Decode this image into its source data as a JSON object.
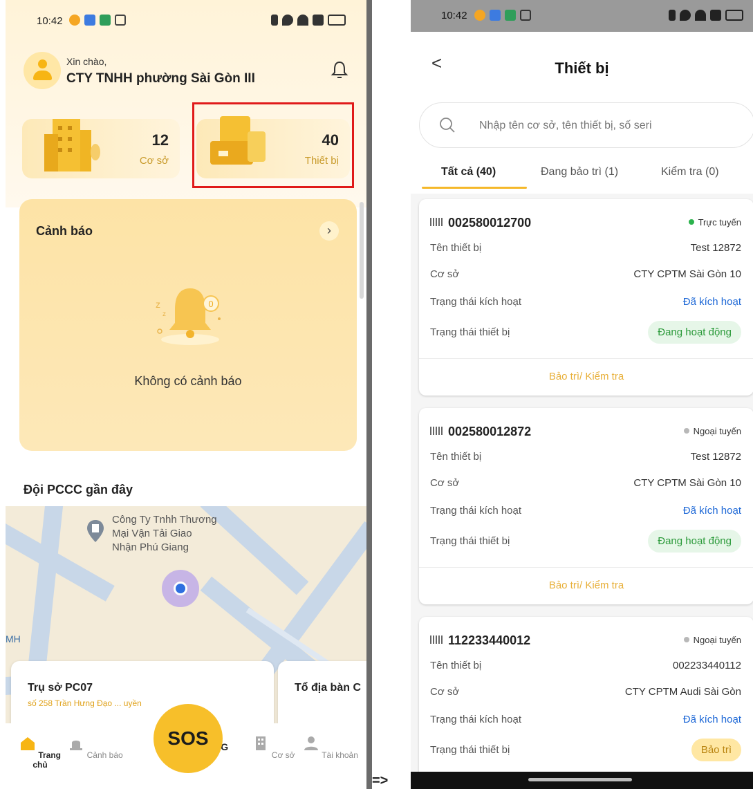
{
  "left_screen": {
    "status_time": "10:42",
    "greeting": "Xin chào,",
    "company": "CTY TNHH phường Sài Gòn III",
    "stats": [
      {
        "value": "12",
        "label": "Cơ sở"
      },
      {
        "value": "40",
        "label": "Thiết bị"
      }
    ],
    "alert": {
      "title": "Cảnh báo",
      "arrow": "›",
      "bell_count": "0",
      "empty_text": "Không có cảnh báo"
    },
    "pccc_title": "Đội PCCC gần đây",
    "map": {
      "place_label_1": "Công Ty Tnhh Thương",
      "place_label_2": "Mại Vận Tải Giao",
      "place_label_3": "Nhận Phú Giang",
      "edge_label": "MH"
    },
    "cards": [
      {
        "title": "Trụ sở PC07",
        "sub": "số 258 Trần Hưng Đạo ... uyền"
      },
      {
        "title": "Tổ địa bàn C",
        "sub": ""
      }
    ],
    "sos": "SOS",
    "nav": [
      {
        "label": "Trang chủ",
        "icon": "home-icon"
      },
      {
        "label": "Cảnh báo",
        "icon": "siren-icon"
      },
      {
        "label": "",
        "icon": "share-icon"
      },
      {
        "label": "G",
        "icon": "phone-icon"
      },
      {
        "label": "Cơ sở",
        "icon": "building-icon"
      },
      {
        "label": "Tài khoản",
        "icon": "user-icon"
      }
    ]
  },
  "arrow": "=>",
  "right_screen": {
    "status_time": "10:42",
    "back": "<",
    "title": "Thiết bị",
    "search_placeholder": "Nhập tên cơ sở, tên thiết bị, số seri",
    "tabs": [
      {
        "label": "Tất cả (40)",
        "active": true
      },
      {
        "label": "Đang bảo trì (1)",
        "active": false
      },
      {
        "label": "Kiểm tra (0)",
        "active": false
      }
    ],
    "labels": {
      "device_name": "Tên thiết bị",
      "facility": "Cơ sở",
      "activation": "Trạng thái kích hoạt",
      "device_state": "Trạng thái thiết bị",
      "action": "Bảo trì/ Kiểm tra"
    },
    "devices": [
      {
        "serial": "002580012700",
        "connection": "Trực tuyến",
        "connection_color": "#2bb24c",
        "name": "Test 12872",
        "facility": "CTY CPTM Sài Gòn 10",
        "activation": "Đã kích hoạt",
        "state": "Đang hoạt động"
      },
      {
        "serial": "002580012872",
        "connection": "Ngoại tuyến",
        "connection_color": "#b8b8b8",
        "name": "Test 12872",
        "facility": "CTY CPTM Sài Gòn 10",
        "activation": "Đã kích hoạt",
        "state": "Đang hoạt động"
      },
      {
        "serial": "112233440012",
        "connection": "Ngoại tuyến",
        "connection_color": "#b8b8b8",
        "name": "002233440112",
        "facility": "CTY CPTM Audi Sài Gòn",
        "activation": "Đã kích hoạt",
        "state": "Bảo trì"
      }
    ]
  },
  "colors": {
    "accent": "#f7b514",
    "highlight_border": "#e01a1a",
    "link": "#1c67d6",
    "action": "#e8b03a"
  }
}
